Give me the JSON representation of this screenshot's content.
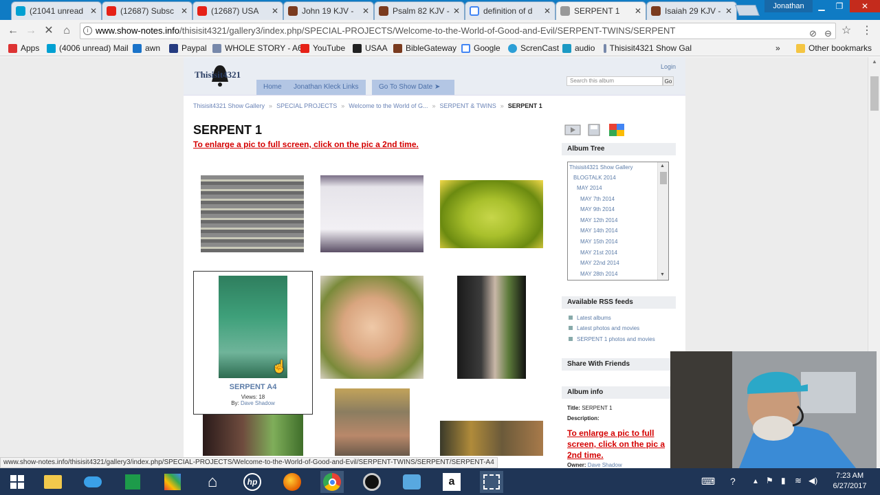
{
  "tabs": [
    {
      "label": "(21041 unread",
      "fav_color": "#00a0d2"
    },
    {
      "label": "(12687) Subsc",
      "fav_color": "#e62117"
    },
    {
      "label": "(12687) USA",
      "fav_color": "#e62117"
    },
    {
      "label": "John 19 KJV -",
      "fav_color": "#7a3b1f"
    },
    {
      "label": "Psalm 82 KJV -",
      "fav_color": "#7a3b1f"
    },
    {
      "label": "definition of d",
      "fav_color": "#4285f4"
    },
    {
      "label": "SERPENT 1",
      "fav_color": "#888888"
    },
    {
      "label": "Isaiah 29 KJV -",
      "fav_color": "#7a3b1f"
    }
  ],
  "profile": "Jonathan",
  "address": {
    "host": "www.show-notes.info",
    "path": "/thisisit4321/gallery3/index.php/SPECIAL-PROJECTS/Welcome-to-the-World-of-Good-and-Evil/SERPENT-TWINS/SERPENT"
  },
  "bookmarks": [
    {
      "label": "Apps",
      "color": "#d33"
    },
    {
      "label": "(4006 unread) Mail",
      "color": "#00a0d2"
    },
    {
      "label": "awn",
      "color": "#1a73c9"
    },
    {
      "label": "Paypal",
      "color": "#253b80"
    },
    {
      "label": "WHOLE STORY - A6",
      "color": "#7788aa"
    },
    {
      "label": "YouTube",
      "color": "#e62117"
    },
    {
      "label": "USAA",
      "color": "#222222"
    },
    {
      "label": "BibleGateway",
      "color": "#7a3b1f"
    },
    {
      "label": "Google",
      "color": "#4285f4"
    },
    {
      "label": "ScrenCast",
      "color": "#2c9fd6"
    },
    {
      "label": "audio",
      "color": "#1c9ac4"
    },
    {
      "label": "Thisisit4321 Show Gal",
      "color": "#7788aa"
    }
  ],
  "bookmarks_more": "»",
  "other_bookmarks": "Other bookmarks",
  "site": {
    "logo": "Thisisit4321",
    "login": "Login",
    "nav": [
      "Home",
      "Jonathan Kleck Links",
      "Go To Show Date ➤"
    ],
    "search_placeholder": "Search this album",
    "search_go": "Go",
    "breadcrumbs": [
      "Thisisit4321 Show Gallery",
      "SPECIAL PROJECTS",
      "Welcome to the World of G...",
      "SERPENT & TWINS",
      "SERPENT 1"
    ],
    "breadcrumb_sep": "»",
    "title": "SERPENT 1",
    "enlarge_note": "To enlarge a pic to full screen, click on the pic a 2nd time."
  },
  "selected_item": {
    "name": "SERPENT A4",
    "views": "Views: 18",
    "by_label": "By:",
    "by_name": "Dave Shadow"
  },
  "sidebar": {
    "album_tree_title": "Album Tree",
    "tree": [
      "Thisisit4321 Show Gallery",
      "BLOGTALK 2014",
      "MAY 2014",
      "MAY 7th 2014",
      "MAY 9th 2014",
      "MAY 12th 2014",
      "MAY 14th 2014",
      "MAY 15th 2014",
      "MAY 21st 2014",
      "MAY 22nd 2014",
      "MAY 28th 2014"
    ],
    "rss_title": "Available RSS feeds",
    "rss": [
      "Latest albums",
      "Latest photos and movies",
      "SERPENT 1 photos and movies"
    ],
    "share_title": "Share With Friends",
    "album_info_title": "Album info",
    "info_title_label": "Title:",
    "info_title_value": "SERPENT 1",
    "info_desc_label": "Description:",
    "info_desc_value": "To enlarge a pic to full screen, click on the pic a 2nd time.",
    "info_owner_label": "Owner:",
    "info_owner_value": "Dave Shadow"
  },
  "status_url": "www.show-notes.info/thisisit4321/gallery3/index.php/SPECIAL-PROJECTS/Welcome-to-the-World-of-Good-and-Evil/SERPENT-TWINS/SERPENT/SERPENT-A4",
  "clock": {
    "time": "7:23 AM",
    "date": "6/27/2017"
  },
  "icons": {
    "back": "back-arrow-icon",
    "forward": "forward-arrow-icon",
    "reload": "reload-icon",
    "home": "home-icon",
    "info": "info-icon",
    "star": "star-icon",
    "menu": "menu-icon"
  }
}
